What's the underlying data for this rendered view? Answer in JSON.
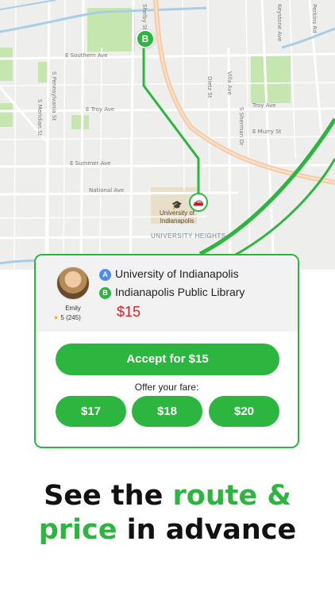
{
  "map": {
    "street_labels": [
      "E Southern Ave",
      "E Troy Ave",
      "E Summer Ave",
      "National Ave",
      "Troy Ave",
      "E Murry St",
      "S Meridian St",
      "S Pennsylvania St",
      "Shelby St",
      "Keystone Ave",
      "Villa Ave",
      "Perkins Rd",
      "Dietz St",
      "S Sherman Dr"
    ],
    "poi_label": "University of Indianapolis",
    "neighborhood_label": "UNIVERSITY HEIGHTS",
    "destination_marker": "B",
    "car_icon": "car-icon"
  },
  "ride_card": {
    "driver": {
      "name": "Emily",
      "rating": "5",
      "reviews": "(245)"
    },
    "pickup": {
      "marker": "A",
      "label": "University of Indianapolis"
    },
    "dropoff": {
      "marker": "B",
      "label": "Indianapolis Public Library"
    },
    "price": "$15",
    "accept_label": "Accept for $15",
    "offer_label": "Offer your fare:",
    "fares": [
      "$17",
      "$18",
      "$20"
    ]
  },
  "headline": {
    "line1_prefix": "See the ",
    "line1_accent": "route &",
    "line2_accent": "price",
    "line2_suffix": " in advance"
  },
  "colors": {
    "accent": "#2db63f",
    "price": "#e02020",
    "pickup_marker": "#4c8bf5"
  }
}
